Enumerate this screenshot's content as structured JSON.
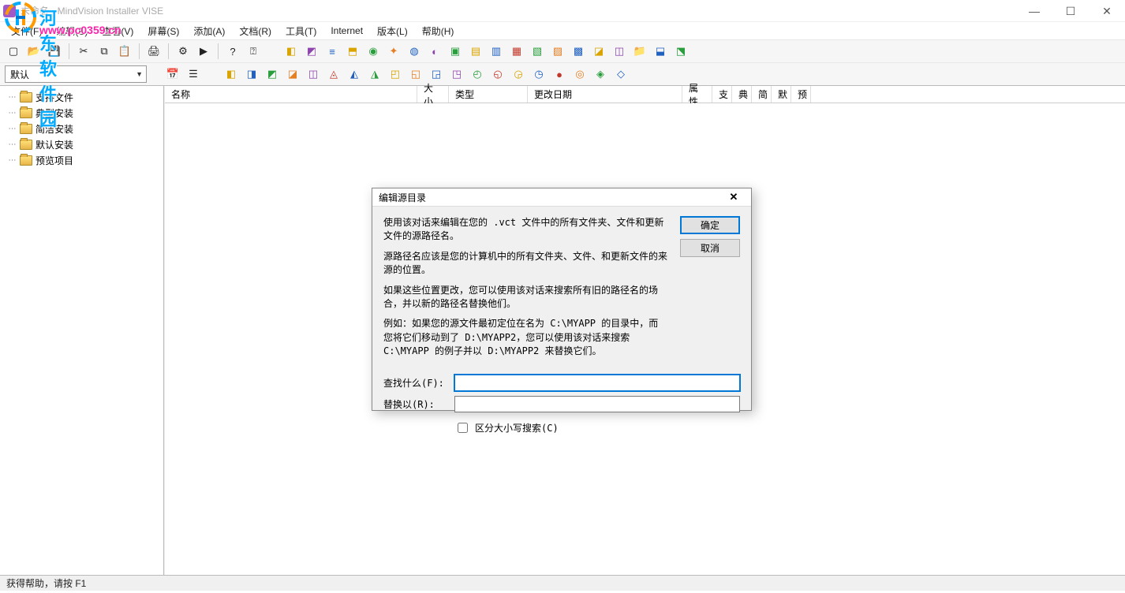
{
  "window": {
    "title": "未命名 - MindVision Installer VISE"
  },
  "watermark": {
    "line1": "河东软件园",
    "line2": "www.pc0359.cn"
  },
  "menu": {
    "file": "文件(F)",
    "edit": "编辑(E)",
    "view": "查看(V)",
    "screen": "屏幕(S)",
    "add": "添加(A)",
    "archive": "文档(R)",
    "tool": "工具(T)",
    "internet": "Internet",
    "version": "版本(L)",
    "help": "帮助(H)"
  },
  "combo": {
    "selected": "默认"
  },
  "tree": {
    "items": [
      {
        "label": "支持文件"
      },
      {
        "label": "典型安装"
      },
      {
        "label": "简洁安装"
      },
      {
        "label": "默认安装"
      },
      {
        "label": "预览项目"
      }
    ]
  },
  "columns": {
    "name": "名称",
    "size": "大小",
    "type": "类型",
    "date": "更改日期",
    "attr": "属性",
    "zhi": "支",
    "dian": "典",
    "jian": "简",
    "mo": "默",
    "yu": "预"
  },
  "status": {
    "text": "获得帮助，请按 F1"
  },
  "dialog": {
    "title": "编辑源目录",
    "p1": "使用该对话来编辑在您的 .vct 文件中的所有文件夹、文件和更新文件的源路径名。",
    "p2": "源路径名应该是您的计算机中的所有文件夹、文件、和更新文件的来源的位置。",
    "p3": "如果这些位置更改，您可以使用该对话来搜索所有旧的路径名的场合，并以新的路径名替换他们。",
    "p4": "例如：如果您的源文件最初定位在名为 C:\\MYAPP 的目录中，而您将它们移动到了 D:\\MYAPP2，您可以使用该对话来搜索 C:\\MYAPP 的例子并以 D:\\MYAPP2 来替换它们。",
    "find_label": "查找什么(F):",
    "replace_label": "替换以(R):",
    "find_value": "",
    "replace_value": "",
    "case_label": "区分大小写搜索(C)",
    "ok": "确定",
    "cancel": "取消"
  }
}
